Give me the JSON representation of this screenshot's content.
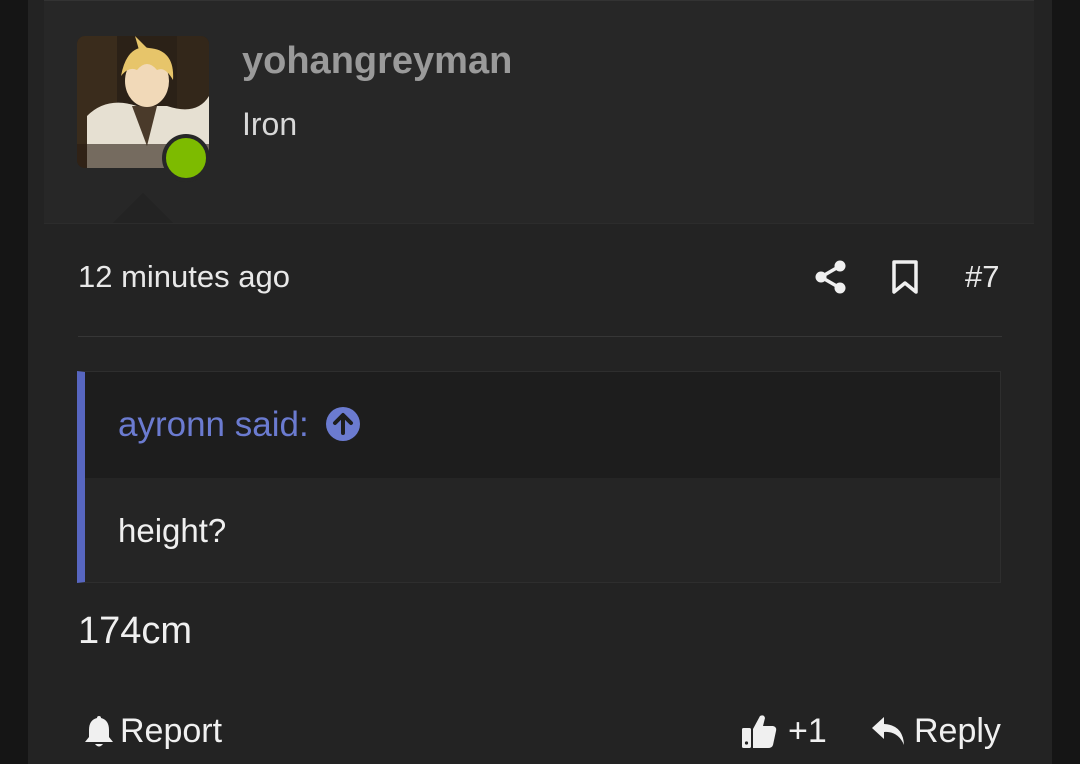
{
  "post": {
    "username": "yohangreyman",
    "user_title": "Iron",
    "timestamp": "12 minutes ago",
    "post_number": "#7",
    "online_status_color": "#7dbb00",
    "quote": {
      "author_label": "ayronn said:",
      "text": "height?",
      "accent_color": "#5766c0"
    },
    "message": "174cm",
    "actions": {
      "report_label": "Report",
      "like_label": "+1",
      "reply_label": "Reply"
    }
  },
  "icons": {
    "share": "share-icon",
    "bookmark": "bookmark-icon",
    "quote_jump": "arrow-up-circle-icon",
    "report": "bell-icon",
    "like": "thumbs-up-icon",
    "reply": "reply-arrow-icon"
  }
}
